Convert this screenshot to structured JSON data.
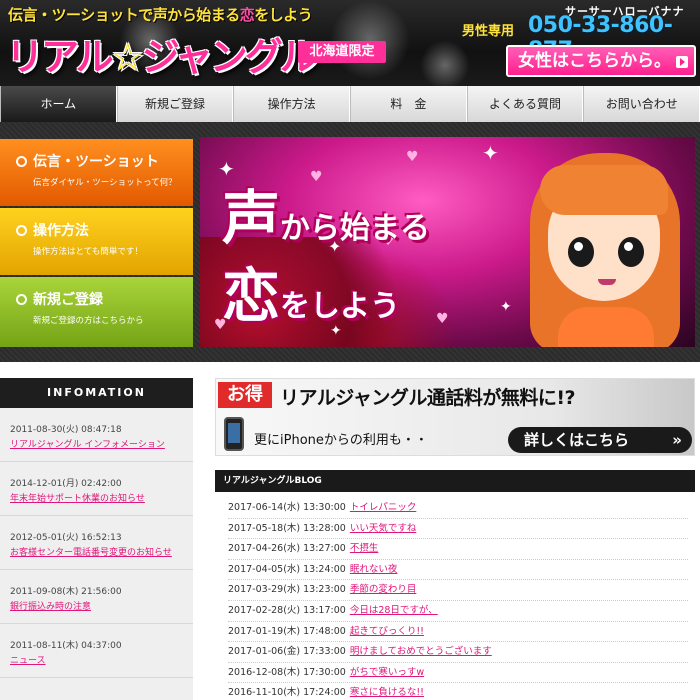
{
  "header": {
    "tagline_pre": "伝言・ツーショットで声から始まる",
    "tagline_pink": "恋",
    "tagline_post": "をしよう",
    "logo_a": "リアル",
    "logo_star": "☆",
    "logo_b": "ジャングル",
    "region": "北海道限定",
    "phone_reading": "サーサーハローバナナ",
    "phone_label": "男性専用",
    "phone_number": "050-33-860-877",
    "female_button": "女性はこちらから。"
  },
  "nav": {
    "items": [
      {
        "label": "ホーム"
      },
      {
        "label": "新規ご登録"
      },
      {
        "label": "操作方法"
      },
      {
        "label": "料　金"
      },
      {
        "label": "よくある質問"
      },
      {
        "label": "お問い合わせ"
      }
    ]
  },
  "side_menu": [
    {
      "title": "伝言・ツーショット",
      "sub": "伝言ダイヤル・ツーショットって何？"
    },
    {
      "title": "操作方法",
      "sub": "操作方法はとても簡単です！"
    },
    {
      "title": "新規ご登録",
      "sub": "新規ご登録の方はこちらから"
    }
  ],
  "hero": {
    "line1_big": "声",
    "line1_small": "から始まる",
    "line2_big": "恋",
    "line2_small": "をしよう"
  },
  "info": {
    "heading": "INFOMATION",
    "items": [
      {
        "date": "2011-08-30(火) 08:47:18",
        "title": "リアルジャングル インフォメーション"
      },
      {
        "date": "2014-12-01(月) 02:42:00",
        "title": "年末年始サポート休業のお知らせ"
      },
      {
        "date": "2012-05-01(火) 16:52:13",
        "title": "お客様センター電話番号変更のお知らせ"
      },
      {
        "date": "2011-09-08(木) 21:56:00",
        "title": "銀行振込み時の注意"
      },
      {
        "date": "2011-08-11(木) 04:37:00",
        "title": "ニュース"
      }
    ]
  },
  "banner": {
    "badge": "お得",
    "title": "リアルジャングル通話料が無料に!?",
    "sub": "更にiPhoneからの利用も・・",
    "button": "詳しくはこちら",
    "button_chev": "»"
  },
  "blog": {
    "heading": "リアルジャングルBLOG",
    "rows": [
      {
        "date": "2017-06-14(水) 13:30:00",
        "title": "トイレパニック"
      },
      {
        "date": "2017-05-18(木) 13:28:00",
        "title": "いい天気ですね"
      },
      {
        "date": "2017-04-26(水) 13:27:00",
        "title": "不摂生"
      },
      {
        "date": "2017-04-05(水) 13:24:00",
        "title": "眠れない夜"
      },
      {
        "date": "2017-03-29(水) 13:23:00",
        "title": "季節の変わり目"
      },
      {
        "date": "2017-02-28(火) 13:17:00",
        "title": "今日は28日ですが、"
      },
      {
        "date": "2017-01-19(木) 17:48:00",
        "title": "起きてびっくり!!"
      },
      {
        "date": "2017-01-06(金) 17:33:00",
        "title": "明けましておめでとうございます"
      },
      {
        "date": "2016-12-08(木) 17:30:00",
        "title": "がちで寒いっすw"
      },
      {
        "date": "2016-11-10(木) 17:24:00",
        "title": "寒さに負けるな!!"
      }
    ]
  }
}
